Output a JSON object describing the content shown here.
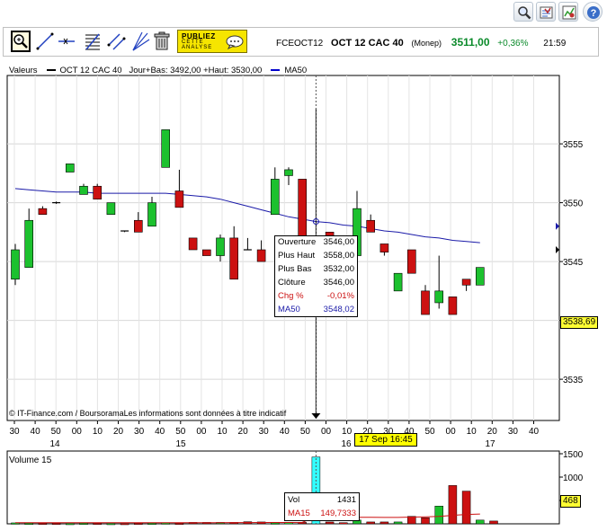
{
  "header": {
    "icons": [
      "zoom-icon",
      "export-icon",
      "settings-icon",
      "help-icon"
    ]
  },
  "toolbar": {
    "tools": [
      "zoom-tool-icon",
      "trend-line-tool-icon",
      "horizontal-line-tool-icon",
      "fibonacci-tool-icon",
      "channel-tool-icon",
      "fan-tool-icon",
      "trash-icon"
    ],
    "promo_line1": "PUBLIEZ",
    "promo_line2": "CETTE",
    "promo_line3": "ANALYSE"
  },
  "quote": {
    "code": "FCEOCT12",
    "name": "OCT 12 CAC 40",
    "market": "(Monep)",
    "price": "3511,00",
    "change": "+0,36%",
    "time": "21:59",
    "up_color": "#0a8a2a"
  },
  "legend": {
    "label": "Valeurs",
    "series": "OCT 12 CAC 40",
    "stats": "Jour+Bas: 3492,00 +Haut: 3530,00",
    "ma": "MA50",
    "ma_color": "#0000cc"
  },
  "tooltip": {
    "rows": [
      {
        "label": "Ouverture",
        "value": "3546,00"
      },
      {
        "label": "Plus Haut",
        "value": "3558,00"
      },
      {
        "label": "Plus Bas",
        "value": "3532,00"
      },
      {
        "label": "Clôture",
        "value": "3546,00"
      },
      {
        "label": "Chg %",
        "value": "-0,01%"
      },
      {
        "label": "MA50",
        "value": "3548,02"
      }
    ]
  },
  "copyright": "© IT-Finance.com / BoursoramaLes informations sont données à titre indicatif",
  "crosshair_label": "17 Sep 16:45",
  "price_marker": "3538,69",
  "volume": {
    "title": "Volume 15",
    "marker": "468",
    "tooltip": {
      "vol_label": "Vol",
      "vol_value": "1431",
      "ma_label": "MA15",
      "ma_value": "149,7333"
    }
  },
  "chart_data": {
    "type": "candlestick",
    "title": "",
    "y_ticks": [
      3535,
      3540,
      3545,
      3550,
      3555
    ],
    "ylim": [
      3531,
      3561
    ],
    "x_tick_labels": [
      "30",
      "40",
      "50",
      "00",
      "10",
      "20",
      "30",
      "40",
      "50",
      "00",
      "10",
      "20",
      "30",
      "40",
      "50",
      "00",
      "10",
      "20",
      "30",
      "40",
      "50",
      "00",
      "10",
      "20",
      "30",
      "40"
    ],
    "day_labels": [
      "14",
      "15",
      "16",
      "17"
    ],
    "colors": {
      "up": "#1cc12e",
      "down": "#cc1111",
      "ma": "#1a1aa8",
      "volume_highlight": "#33ffff"
    },
    "candles": [
      {
        "o": 3543.5,
        "h": 3546.5,
        "l": 3543.0,
        "c": 3546.0
      },
      {
        "o": 3544.5,
        "h": 3549.5,
        "l": 3544.5,
        "c": 3548.5
      },
      {
        "o": 3549.5,
        "h": 3549.7,
        "l": 3549.0,
        "c": 3549.0
      },
      {
        "o": 3550.0,
        "h": 3550.1,
        "l": 3549.9,
        "c": 3550.0
      },
      {
        "o": 3552.6,
        "h": 3553.3,
        "l": 3552.6,
        "c": 3553.3
      },
      {
        "o": 3550.7,
        "h": 3551.6,
        "l": 3550.7,
        "c": 3551.4
      },
      {
        "o": 3551.4,
        "h": 3551.6,
        "l": 3550.3,
        "c": 3550.3
      },
      {
        "o": 3549.0,
        "h": 3550.0,
        "l": 3549.0,
        "c": 3550.0
      },
      {
        "o": 3547.6,
        "h": 3547.6,
        "l": 3547.5,
        "c": 3547.5
      },
      {
        "o": 3548.5,
        "h": 3549.2,
        "l": 3547.5,
        "c": 3547.5
      },
      {
        "o": 3548.0,
        "h": 3550.5,
        "l": 3548.0,
        "c": 3550.0
      },
      {
        "o": 3553.0,
        "h": 3556.2,
        "l": 3553.0,
        "c": 3556.2
      },
      {
        "o": 3551.0,
        "h": 3552.8,
        "l": 3549.6,
        "c": 3549.6
      },
      {
        "o": 3547.0,
        "h": 3547.0,
        "l": 3546.0,
        "c": 3546.0
      },
      {
        "o": 3546.0,
        "h": 3546.0,
        "l": 3545.5,
        "c": 3545.5
      },
      {
        "o": 3545.5,
        "h": 3547.3,
        "l": 3545.0,
        "c": 3547.0
      },
      {
        "o": 3547.0,
        "h": 3548.0,
        "l": 3543.5,
        "c": 3543.5
      },
      {
        "o": 3546.0,
        "h": 3547.0,
        "l": 3546.0,
        "c": 3546.0
      },
      {
        "o": 3546.0,
        "h": 3546.8,
        "l": 3545.0,
        "c": 3545.0
      },
      {
        "o": 3549.0,
        "h": 3553.0,
        "l": 3549.0,
        "c": 3552.0
      },
      {
        "o": 3552.3,
        "h": 3553.0,
        "l": 3551.5,
        "c": 3552.8
      },
      {
        "o": 3552.0,
        "h": 3552.0,
        "l": 3544.0,
        "c": 3544.0
      },
      {
        "o": 3546.0,
        "h": 3558.0,
        "l": 3532.0,
        "c": 3546.0
      },
      {
        "o": 3547.5,
        "h": 3547.5,
        "l": 3542.5,
        "c": 3545.0
      },
      {
        "o": 3546.0,
        "h": 3546.0,
        "l": 3545.8,
        "c": 3546.0
      },
      {
        "o": 3545.5,
        "h": 3551.0,
        "l": 3545.5,
        "c": 3549.5
      },
      {
        "o": 3548.5,
        "h": 3549.0,
        "l": 3547.5,
        "c": 3547.5
      },
      {
        "o": 3546.5,
        "h": 3546.5,
        "l": 3545.5,
        "c": 3545.8
      },
      {
        "o": 3542.5,
        "h": 3544.0,
        "l": 3542.5,
        "c": 3544.0
      },
      {
        "o": 3546.0,
        "h": 3546.0,
        "l": 3544.0,
        "c": 3544.0
      },
      {
        "o": 3542.5,
        "h": 3543.0,
        "l": 3540.5,
        "c": 3540.5
      },
      {
        "o": 3541.5,
        "h": 3545.5,
        "l": 3541.0,
        "c": 3542.5
      },
      {
        "o": 3542.0,
        "h": 3542.0,
        "l": 3540.5,
        "c": 3540.5
      },
      {
        "o": 3543.5,
        "h": 3543.5,
        "l": 3542.5,
        "c": 3543.0
      },
      {
        "o": 3543.0,
        "h": 3544.5,
        "l": 3543.0,
        "c": 3544.5
      }
    ],
    "ma50": [
      3551.2,
      3551.1,
      3551.0,
      3550.9,
      3550.9,
      3550.9,
      3550.8,
      3550.8,
      3550.8,
      3550.8,
      3550.8,
      3550.8,
      3550.7,
      3550.6,
      3550.5,
      3550.3,
      3550.0,
      3549.7,
      3549.4,
      3549.1,
      3548.8,
      3548.6,
      3548.4,
      3548.3,
      3548.1,
      3548.0,
      3547.8,
      3547.6,
      3547.5,
      3547.3,
      3547.1,
      3547.0,
      3546.8,
      3546.7,
      3546.6
    ],
    "volume_ticks": [
      500,
      1000,
      1500
    ],
    "volume": [
      20,
      15,
      15,
      15,
      10,
      15,
      15,
      10,
      10,
      15,
      15,
      20,
      15,
      30,
      30,
      30,
      30,
      45,
      40,
      20,
      25,
      30,
      1431,
      40,
      25,
      80,
      40,
      40,
      40,
      160,
      130,
      380,
      820,
      700,
      80,
      60
    ],
    "volume_ma15": [
      25,
      25,
      25,
      24,
      24,
      24,
      24,
      23,
      23,
      23,
      23,
      23,
      23,
      24,
      24,
      25,
      26,
      27,
      28,
      28,
      29,
      30,
      150,
      140,
      138,
      140,
      138,
      137,
      136,
      145,
      150,
      160,
      180,
      200,
      210
    ]
  }
}
